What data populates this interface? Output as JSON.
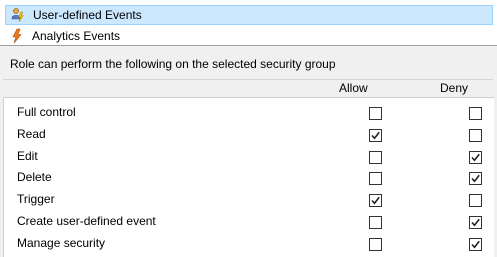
{
  "tree": {
    "items": [
      {
        "label": "User-defined Events",
        "selected": true,
        "icon": "user-defined-event-icon"
      },
      {
        "label": "Analytics Events",
        "selected": false,
        "icon": "analytics-event-icon"
      }
    ]
  },
  "permissions": {
    "title": "Role can perform the following on the selected security group",
    "allow_label": "Allow",
    "deny_label": "Deny",
    "rows": [
      {
        "label": "Full control",
        "allow": false,
        "deny": false
      },
      {
        "label": "Read",
        "allow": true,
        "deny": false
      },
      {
        "label": "Edit",
        "allow": false,
        "deny": true
      },
      {
        "label": "Delete",
        "allow": false,
        "deny": true
      },
      {
        "label": "Trigger",
        "allow": true,
        "deny": false
      },
      {
        "label": "Create user-defined event",
        "allow": false,
        "deny": true
      },
      {
        "label": "Manage security",
        "allow": false,
        "deny": true
      }
    ]
  }
}
